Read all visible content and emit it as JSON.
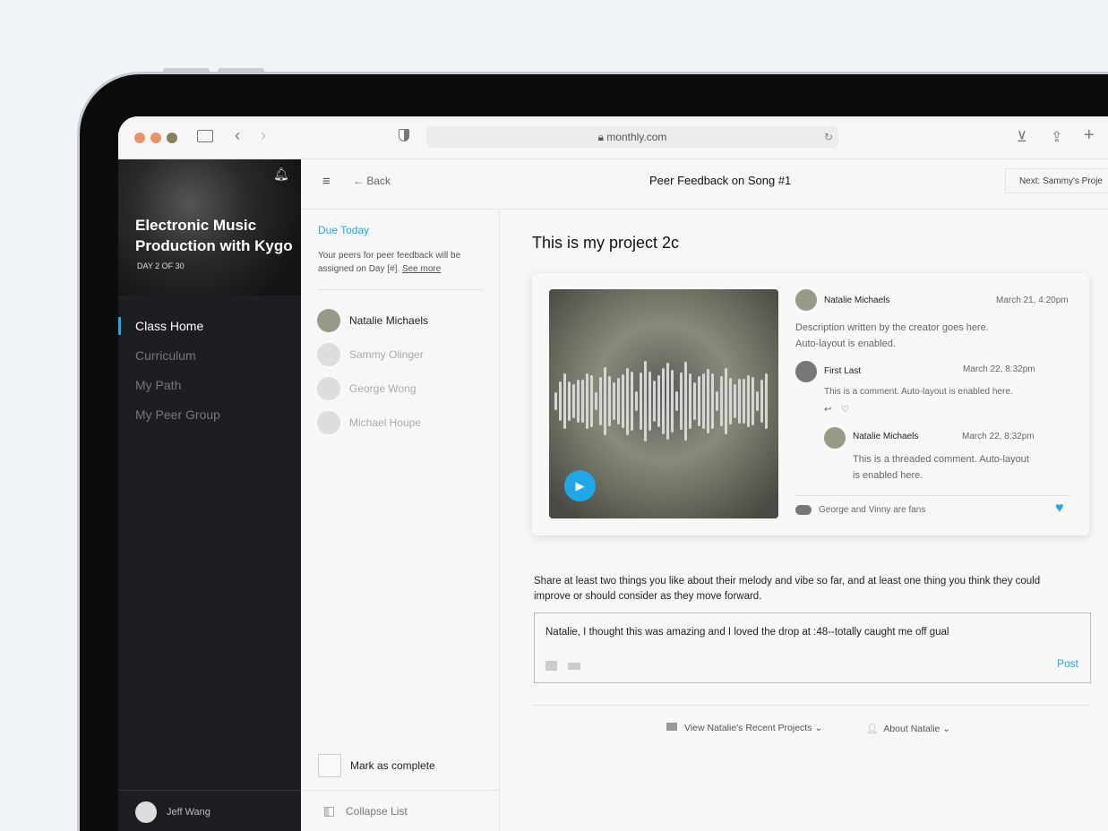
{
  "browser": {
    "url": "monthly.com"
  },
  "course": {
    "title_line1": "Electronic Music",
    "title_line2": "Production with Kygo",
    "day": "DAY 2 OF 30"
  },
  "sidebar": {
    "items": [
      {
        "label": "Class Home"
      },
      {
        "label": "Curriculum"
      },
      {
        "label": "My Path"
      },
      {
        "label": "My Peer Group"
      }
    ],
    "user": "Jeff Wang"
  },
  "header": {
    "back": "Back",
    "title": "Peer Feedback on Song #1",
    "next": "Next: Sammy's Proje"
  },
  "due": {
    "title": "Due Today",
    "text_line1": "Your peers for peer feedback will be",
    "text_line2": "assigned on  Day [#].",
    "see_more": "See more"
  },
  "peers": [
    {
      "name": "Natalie Michaels"
    },
    {
      "name": "Sammy Olinger"
    },
    {
      "name": "George Wong"
    },
    {
      "name": "Michael Houpe"
    }
  ],
  "mark_complete": "Mark as complete",
  "collapse": "Collapse List",
  "project": {
    "title": "This is my project 2c",
    "creator": {
      "name": "Natalie Michaels",
      "time": "March 21, 4:20pm",
      "desc_line1": "Description written by the creator goes here.",
      "desc_line2": "Auto-layout is enabled."
    },
    "comment": {
      "name": "First Last",
      "time": "March 22, 8:32pm",
      "text": "This is a comment. Auto-layout is enabled here."
    },
    "reply": {
      "name": "Natalie Michaels",
      "time": "March 22, 8:32pm",
      "text_line1": "This is a threaded comment. Auto-layout",
      "text_line2": "is enabled here."
    },
    "fans": "George and Vinny are fans"
  },
  "prompt": {
    "line1": "Share at least two things you like about their melody and vibe so far, and at least one thing you think they could",
    "line2": "improve or should consider as they move forward."
  },
  "feedback": {
    "value": "Natalie, I thought this was amazing and I loved the drop at :48--totally caught me off gual",
    "post": "Post"
  },
  "links": {
    "recent": "View Natalie's Recent Projects",
    "about": "About Natalie"
  },
  "colors": {
    "accent": "#1fa7e8",
    "sidebar": "#1d1e22"
  }
}
